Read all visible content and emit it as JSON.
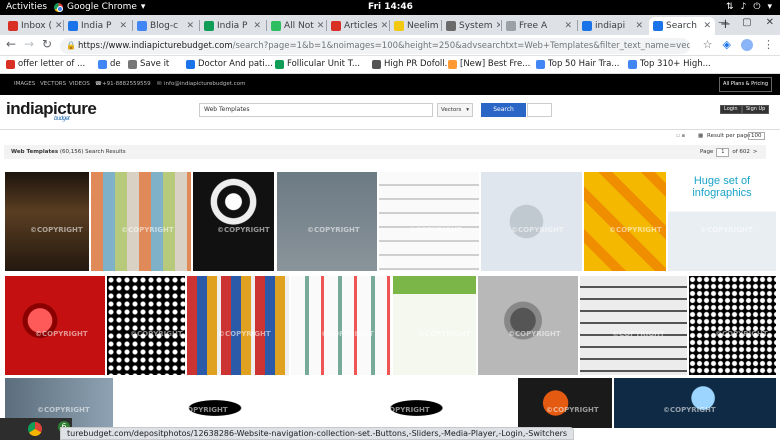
{
  "gnome": {
    "activities": "Activities",
    "app": "Google Chrome",
    "clock": "Fri 14:46"
  },
  "tabs": [
    {
      "label": "Inbox (",
      "icon": "gmail-icon",
      "color": "#d93025"
    },
    {
      "label": "India P",
      "icon": "indiapicture-icon",
      "color": "#1a73e8"
    },
    {
      "label": "Blog-c",
      "icon": "docs-icon",
      "color": "#4285f4"
    },
    {
      "label": "India P",
      "icon": "sheets-icon",
      "color": "#0f9d58"
    },
    {
      "label": "All Not",
      "icon": "evernote-icon",
      "color": "#2dbe60"
    },
    {
      "label": "Articles",
      "icon": "articles-icon",
      "color": "#d93025"
    },
    {
      "label": "Neelim",
      "icon": "neelima-icon",
      "color": "#f2c811"
    },
    {
      "label": "System",
      "icon": "system-icon",
      "color": "#6b6b6b"
    },
    {
      "label": "Free A",
      "icon": "page-icon",
      "color": "#9aa0a6"
    },
    {
      "label": "indiapi",
      "icon": "indiapicture-icon",
      "color": "#1a73e8"
    },
    {
      "label": "Search",
      "icon": "indiapicture-icon",
      "color": "#1a73e8"
    }
  ],
  "new_tab": "+",
  "address": {
    "host": "https://www.indiapicturebudget.com",
    "path": "/search?page=1&b=1&noimages=100&height=250&advsearchtxt=Web+Templates&filter_text_name=vector&search_btn=S"
  },
  "bookmarks": [
    {
      "label": "offer letter of ...",
      "color": "#d93025"
    },
    {
      "label": "de",
      "color": "#4285f4"
    },
    {
      "label": "Save it",
      "color": "#777"
    },
    {
      "label": "Doctor And pati...",
      "color": "#1a73e8"
    },
    {
      "label": "Follicular Unit T...",
      "color": "#0f9d58"
    },
    {
      "label": "High PR Dofoll...",
      "color": "#555"
    },
    {
      "label": "[New] Best Fre...",
      "color": "#ff9933"
    },
    {
      "label": "Top 50 Hair Tra...",
      "color": "#4285f4"
    },
    {
      "label": "Top 310+ High...",
      "color": "#4285f4"
    }
  ],
  "site": {
    "top_links": [
      "IMAGES",
      "VECTORS",
      "VIDEOS"
    ],
    "phone": "+91-8882559559",
    "email": "info@indiapicturebudget.com",
    "plans_button": "All Plans & Pricing",
    "logo": "indiapicture",
    "logo_sub": "budget",
    "search_value": "Web Templates",
    "search_type": "Vectors",
    "search_button": "Search",
    "login": "Login",
    "signup": "Sign Up",
    "result_per_page_label": "Result per page",
    "result_per_page_value": "100",
    "results_title": "Web Templates",
    "results_count": "(60,156) Search Results",
    "page_label": "Page",
    "page_value": "1",
    "page_total": "of 602",
    "page_next": ">",
    "watermark": "©COPYRIGHT"
  },
  "thumbs": [
    {
      "name": "website-template-dark-thumbnail",
      "bg": "#3a2a1a"
    },
    {
      "name": "web-buttons-colorful-thumbnail",
      "bg": "#d9d2c4"
    },
    {
      "name": "abstract-black-pattern-thumbnail",
      "bg": "#111"
    },
    {
      "name": "vintage-frames-thumbnail",
      "bg": "#6c7a84"
    },
    {
      "name": "white-banners-thumbnail",
      "bg": "#e8e8e8"
    },
    {
      "name": "globe-arrows-thumbnail",
      "bg": "#dfe6ee"
    },
    {
      "name": "photo-frames-yellow-thumbnail",
      "bg": "#f5b800"
    },
    {
      "name": "infographics-set-thumbnail",
      "bg": "#ffffff"
    },
    {
      "name": "red-button-thumbnail",
      "bg": "#c41010"
    },
    {
      "name": "halftone-dots-thumbnail",
      "bg": "#000"
    },
    {
      "name": "vertical-banners-thumbnail",
      "bg": "#f0f0f0"
    },
    {
      "name": "web-elements-kit-thumbnail",
      "bg": "#fafafa"
    },
    {
      "name": "website-green-ui-thumbnail",
      "bg": "#f4f8ee"
    },
    {
      "name": "grey-orange-button-thumbnail",
      "bg": "#9a9a9a"
    },
    {
      "name": "ui-buttons-grey-thumbnail",
      "bg": "#ececec"
    },
    {
      "name": "halftone-wave-thumbnail",
      "bg": "#000"
    },
    {
      "name": "colorful-app-icons-thumbnail",
      "bg": "#6b7d8c"
    },
    {
      "name": "fire-icon-thumbnail",
      "bg": "#fff"
    },
    {
      "name": "fire-icon-thumbnail",
      "bg": "#fff"
    },
    {
      "name": "orange-swirl-thumbnail",
      "bg": "#1a1a1a"
    },
    {
      "name": "media-player-ui-thumbnail",
      "bg": "#0f2a44"
    }
  ],
  "status_url": "turebudget.com/depositphotos/12638286-Website-navigation-collection-set.-Buttons,-Sliders,-Media-Player,-Login,-Switchers",
  "dock_badge": "6"
}
